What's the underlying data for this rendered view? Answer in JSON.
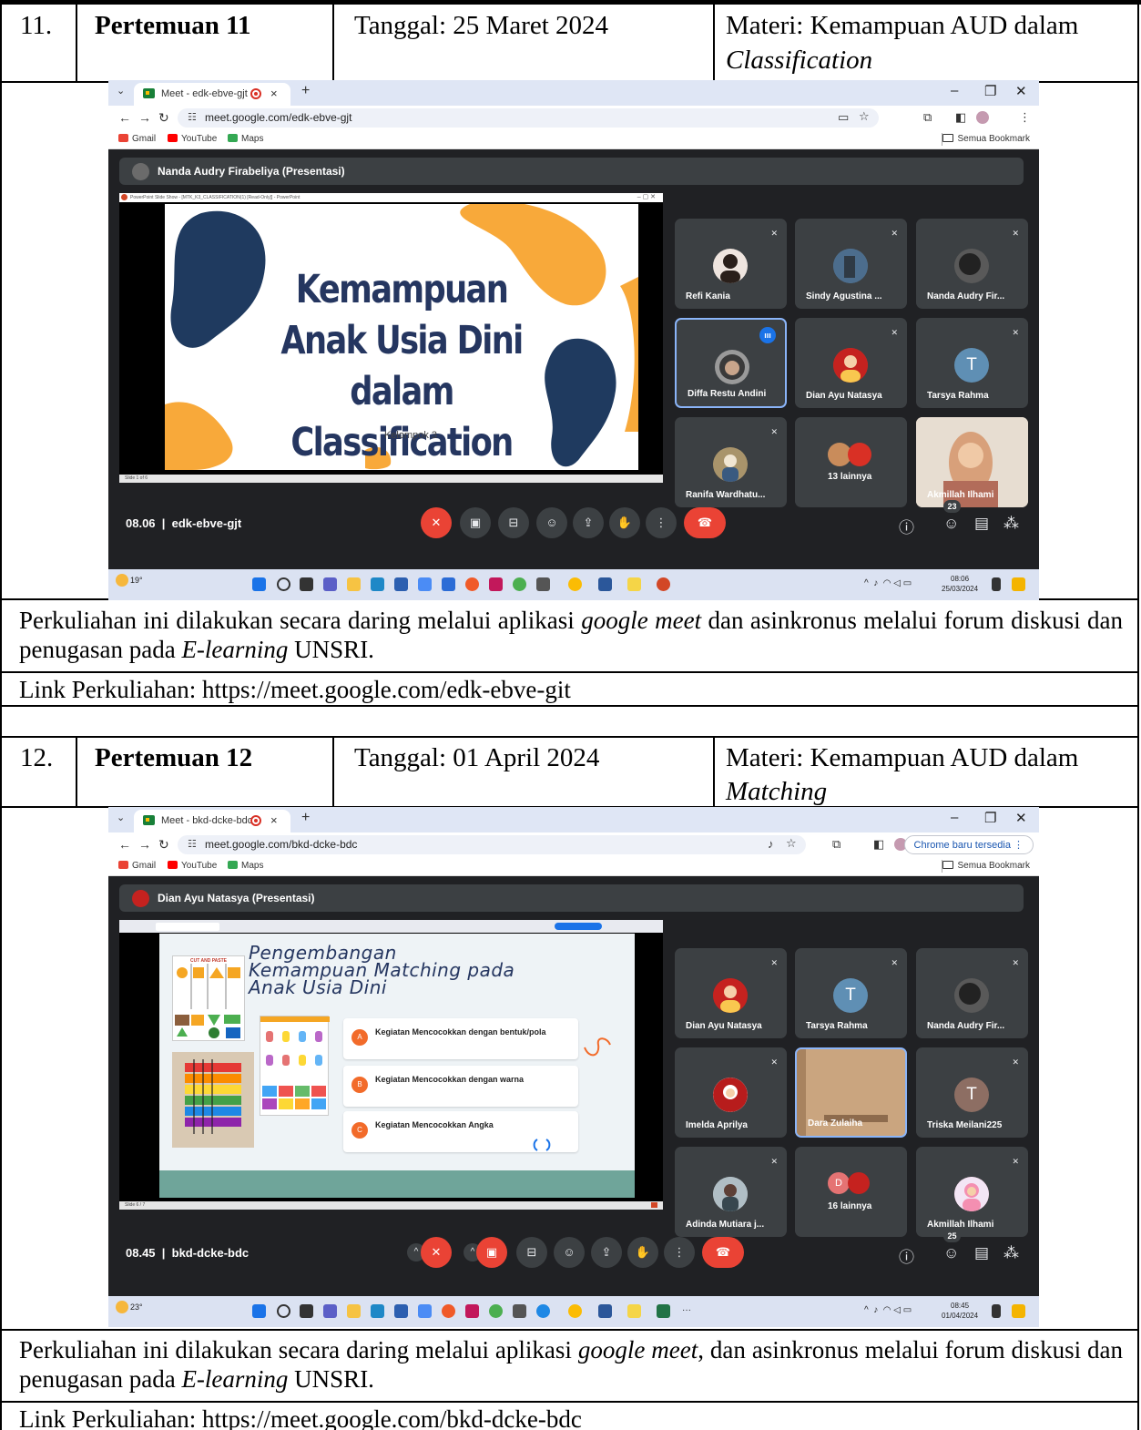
{
  "meetings": [
    {
      "number": "11.",
      "title": "Pertemuan 11",
      "date": "Tanggal: 25 Maret 2024",
      "materi_label": "Materi: Kemampuan AUD dalam",
      "materi_topic": "Classification",
      "screenshot": {
        "tab_title": "Meet - edk-ebve-gjt",
        "url": "meet.google.com/edk-ebve-gjt",
        "bookmarks": [
          "Gmail",
          "YouTube",
          "Maps"
        ],
        "bookmarks_all": "Semua Bookmark",
        "presenter": "Nanda Audry Firabeliya (Presentasi)",
        "window_caption": "PowerPoint Slide Show - [MTK_K3_CLASSIFICATION(1) [Read-Only]] - PowerPoint",
        "slide_title": "Kemampuan Anak Usia Dini dalam Classification",
        "slide_subtitle": "Kelompok 3",
        "slide_status": "Slide 1 of 6",
        "participants": [
          "Refi Kania",
          "Sindy Agustina ...",
          "Nanda Audry Fir...",
          "Diffa Restu Andini",
          "Dian Ayu Natasya",
          "Tarsya Rahma",
          "Ranifa Wardhatu...",
          "13 lainnya",
          "Akmillah Ilhami"
        ],
        "time": "08.06",
        "meeting_code": "edk-ebve-gjt",
        "people_count": "23",
        "weather": "19°",
        "clock_time": "08:06",
        "clock_date": "25/03/2024"
      },
      "paragraph_before": "Perkuliahan ini dilakukan secara daring melalui aplikasi ",
      "paragraph_italic1": "google meet",
      "paragraph_middle": " dan asinkronus melalui forum diskusi dan penugasan pada ",
      "paragraph_italic2": "E-learning",
      "paragraph_after": " UNSRI.",
      "link": "Link Perkuliahan: https://meet.google.com/edk-ebve-git"
    },
    {
      "number": "12.",
      "title": "Pertemuan 12",
      "date": "Tanggal: 01 April 2024",
      "materi_label": "Materi: Kemampuan AUD dalam",
      "materi_topic": "Matching",
      "screenshot": {
        "tab_title": "Meet - bkd-dcke-bdc",
        "url": "meet.google.com/bkd-dcke-bdc",
        "bookmarks": [
          "Gmail",
          "YouTube",
          "Maps"
        ],
        "bookmarks_all": "Semua Bookmark",
        "chrome_update": "Chrome baru tersedia",
        "presenter": "Dian Ayu Natasya (Presentasi)",
        "slide_title_lines": [
          "Pengembangan",
          "Kemampuan Matching pada",
          "Anak Usia Dini"
        ],
        "slide_image_label": "CUT AND PASTE",
        "cards": [
          {
            "letter": "A",
            "text": "Kegiatan Mencocokkan dengan bentuk/pola"
          },
          {
            "letter": "B",
            "text": "Kegiatan Mencocokkan dengan warna"
          },
          {
            "letter": "C",
            "text": "Kegiatan Mencocokkan Angka"
          }
        ],
        "slide_status": "Slide 6 / 7",
        "participants": [
          "Dian Ayu Natasya",
          "Tarsya Rahma",
          "Nanda Audry Fir...",
          "Imelda Aprilya",
          "Dara Zulaiha",
          "Triska Meilani225",
          "Adinda Mutiara j...",
          "16 lainnya",
          "Akmillah Ilhami"
        ],
        "time": "08.45",
        "meeting_code": "bkd-dcke-bdc",
        "people_count": "25",
        "weather": "23°",
        "clock_time": "08:45",
        "clock_date": "01/04/2024"
      },
      "paragraph_before": "Perkuliahan ini dilakukan secara daring melalui aplikasi ",
      "paragraph_italic1": "google meet",
      "paragraph_middle": ", dan asinkronus melalui forum diskusi dan penugasan pada ",
      "paragraph_italic2": "E-learning",
      "paragraph_after": " UNSRI.",
      "link": "Link Perkuliahan: https://meet.google.com/bkd-dcke-bdc"
    }
  ],
  "colors": {
    "meet_bg": "#202124",
    "tile_bg": "#3c4043",
    "end_call": "#ea4335",
    "slide_navy": "#253660",
    "blob_orange": "#f8a93a",
    "blob_navy": "#1f3a5f"
  },
  "icons": [
    "mic-off-icon",
    "camera-icon",
    "captions-icon",
    "emoji-icon",
    "present-icon",
    "hand-raise-icon",
    "more-options-icon",
    "end-call-icon",
    "info-icon",
    "people-icon",
    "chat-icon",
    "activities-icon"
  ]
}
